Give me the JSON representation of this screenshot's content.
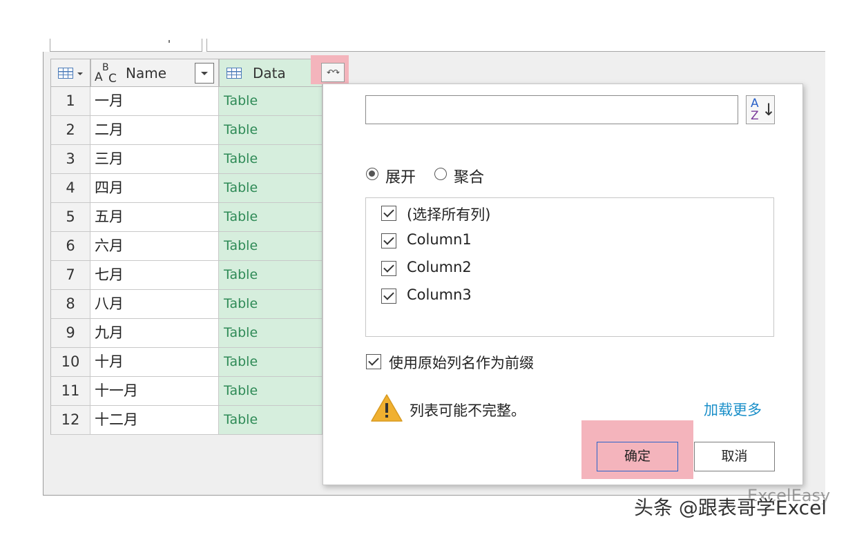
{
  "columns": {
    "name_type_icon": "ABC",
    "name_label": "Name",
    "data_label": "Data",
    "expand_icon": "expand-columns-icon"
  },
  "rows": [
    {
      "num": "1",
      "name": "一月",
      "data": "Table"
    },
    {
      "num": "2",
      "name": "二月",
      "data": "Table"
    },
    {
      "num": "3",
      "name": "三月",
      "data": "Table"
    },
    {
      "num": "4",
      "name": "四月",
      "data": "Table"
    },
    {
      "num": "5",
      "name": "五月",
      "data": "Table"
    },
    {
      "num": "6",
      "name": "六月",
      "data": "Table"
    },
    {
      "num": "7",
      "name": "七月",
      "data": "Table"
    },
    {
      "num": "8",
      "name": "八月",
      "data": "Table"
    },
    {
      "num": "9",
      "name": "九月",
      "data": "Table"
    },
    {
      "num": "10",
      "name": "十月",
      "data": "Table"
    },
    {
      "num": "11",
      "name": "十一月",
      "data": "Table"
    },
    {
      "num": "12",
      "name": "十二月",
      "data": "Table"
    }
  ],
  "popup": {
    "search_value": "",
    "radio_expand": "展开",
    "radio_aggregate": "聚合",
    "selected_mode": "展开",
    "items": [
      {
        "label": "(选择所有列)",
        "checked": true
      },
      {
        "label": "Column1",
        "checked": true
      },
      {
        "label": "Column2",
        "checked": true
      },
      {
        "label": "Column3",
        "checked": true
      }
    ],
    "prefix_label": "使用原始列名作为前缀",
    "prefix_checked": true,
    "warning_text": "列表可能不完整。",
    "load_more": "加载更多",
    "ok_label": "确定",
    "cancel_label": "取消"
  },
  "watermark": "头条 @跟表哥学Excel",
  "watermark_faint": "ExcelEasy",
  "colors": {
    "data_cell_bg": "#d6eedd",
    "data_cell_text": "#2e8a56",
    "highlight": "#f4b4bc",
    "link": "#1a8fc9",
    "warning": "#f0b030"
  }
}
